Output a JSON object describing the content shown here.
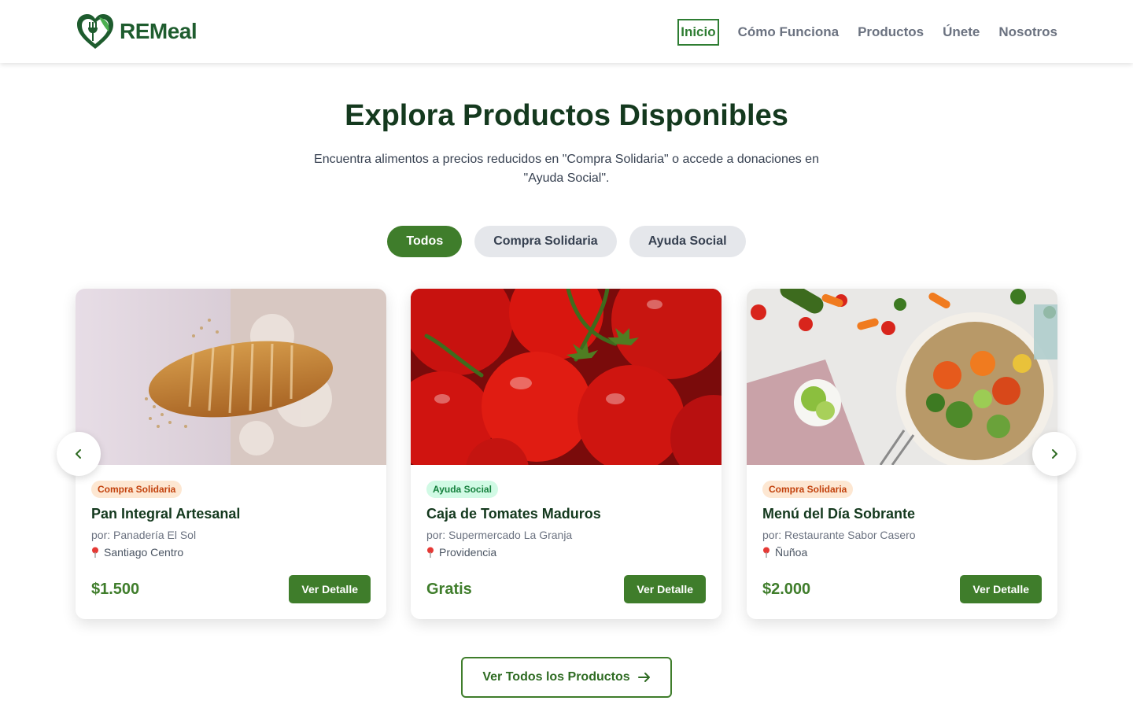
{
  "brand": {
    "name": "REMeal",
    "primary_color": "#3f7d2b",
    "dark_color": "#14391e"
  },
  "nav": {
    "items": [
      {
        "label": "Inicio",
        "active": true
      },
      {
        "label": "Cómo Funciona"
      },
      {
        "label": "Productos"
      },
      {
        "label": "Únete"
      },
      {
        "label": "Nosotros"
      }
    ]
  },
  "hero": {
    "title": "Explora Productos Disponibles",
    "subtitle": "Encuentra alimentos a precios reducidos en \"Compra Solidaria\" o accede a donaciones en \"Ayuda Social\"."
  },
  "filters": [
    {
      "label": "Todos",
      "active": true
    },
    {
      "label": "Compra Solidaria"
    },
    {
      "label": "Ayuda Social"
    }
  ],
  "products": [
    {
      "badge": "Compra Solidaria",
      "title": "Pan Integral Artesanal",
      "vendor": "por: Panadería El Sol",
      "location": "Santiago Centro",
      "price": "$1.500",
      "button": "Ver Detalle",
      "image": "sliced-bread-photo"
    },
    {
      "badge": "Ayuda Social",
      "title": "Caja de Tomates Maduros",
      "vendor": "por: Supermercado La Granja",
      "location": "Providencia",
      "price": "Gratis",
      "button": "Ver Detalle",
      "image": "tomatoes-photo"
    },
    {
      "badge": "Compra Solidaria",
      "title": "Menú del Día Sobrante",
      "vendor": "por: Restaurante Sabor Casero",
      "location": "Ñuñoa",
      "price": "$2.000",
      "button": "Ver Detalle",
      "image": "vegetable-bowl-photo"
    }
  ],
  "carousel": {
    "prev_icon": "chevron-left-icon",
    "next_icon": "chevron-right-icon"
  },
  "cta": {
    "label": "Ver Todos los Productos",
    "icon": "arrow-right-icon"
  }
}
